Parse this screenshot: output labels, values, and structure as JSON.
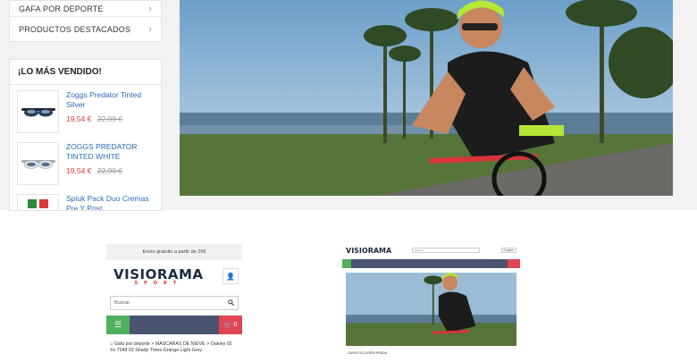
{
  "categories": [
    {
      "label": "GAFA POR DEPORTE"
    },
    {
      "label": "PRODUCTOS DESTACADOS"
    }
  ],
  "best_sellers": {
    "title": "¡LO MÁS VENDIDO!",
    "products": [
      {
        "name": "Zoggs Predator Tinted Silver",
        "price": "19,54 €",
        "old_price": "22,99 €",
        "icon": "goggles-icon"
      },
      {
        "name": "ZOGGS PREDATOR TINTED WHITE",
        "price": "19,54 €",
        "old_price": "22,99 €",
        "icon": "goggles-icon"
      },
      {
        "name": "Spiuk Pack Duo Cremas Pre Y Post",
        "price": "",
        "old_price": "",
        "icon": "cream-icon"
      }
    ]
  },
  "mobile_preview": {
    "shipping": "Envío gratuito a partir de 20€",
    "logo": "VISIORAMA",
    "logo_sub": "SPORT",
    "search_placeholder": "Buscar",
    "cart_count": "0",
    "breadcrumb": "Gafa por deporte > MASCARAS DE NIEVE > Oakley 02 Xs 7048 02 Shady Trees Grange Light Grey"
  },
  "desktop_preview": {
    "logo": "VISIORAMA",
    "search_placeholder": "Buscar",
    "lang": "English",
    "caption": "GAFAS OCLUSIÓN PRADA"
  },
  "colors": {
    "nav": "#4a5370",
    "menu": "#4fb05e",
    "cart": "#e14553",
    "link": "#2a6ab8",
    "price": "#e0393e"
  }
}
